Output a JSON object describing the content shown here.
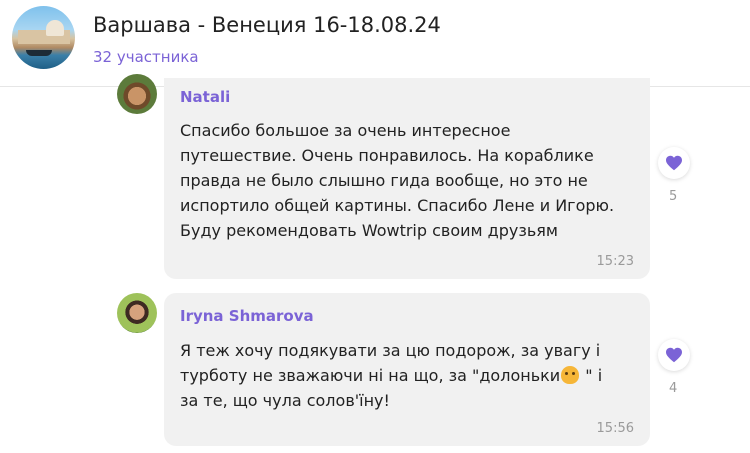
{
  "header": {
    "title": "Варшава - Венеция 16-18.08.24",
    "subtitle": "32 участника"
  },
  "messages": [
    {
      "sender": "Natali",
      "lines": [
        "Спасибо большое за очень интересное",
        "путешествие. Очень  понравилось. На кораблике",
        "правда не было слышно гида вообще, но это не",
        "испортило общей картины. Спасибо Лене и Игорю.",
        "Буду рекомендовать Wowtrip своим друзьям"
      ],
      "time": "15:23",
      "reaction_icon": "heart-icon",
      "reaction_count": "5"
    },
    {
      "sender": "Iryna Shmarova",
      "lines": [
        "Я теж хочу подякувати за цю подорож, за увагу і",
        "турботу не зважаючи ні на що, за \"долоньки",
        " \" і",
        "за те, що чула солов'їну!"
      ],
      "time": "15:56",
      "reaction_icon": "heart-icon",
      "reaction_count": "4"
    }
  ],
  "colors": {
    "accent": "#7b63d6",
    "bubble": "#f1f1f1",
    "timestamp": "#9a9a9a"
  }
}
